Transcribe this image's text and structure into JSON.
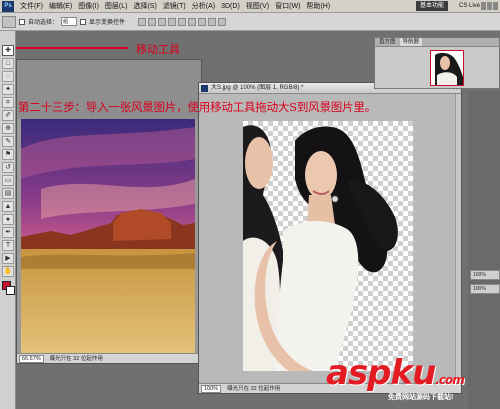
{
  "menubar": {
    "logo": "Ps",
    "items": [
      "文件(F)",
      "编辑(E)",
      "图像(I)",
      "图层(L)",
      "选择(S)",
      "滤镜(T)",
      "分析(A)",
      "3D(D)",
      "视图(V)",
      "窗口(W)",
      "帮助(H)"
    ],
    "zoom": "100%",
    "workspace": "基本功能",
    "cslive": "CS Live"
  },
  "options": {
    "auto_select_label": "自动选择：",
    "auto_select_value": "组",
    "show_transform_label": "显示变换控件"
  },
  "annotations": {
    "move_tool": "移动工具",
    "step": "第二十三步：导入一张风景图片，使用移动工具拖动大S到风景图片里。"
  },
  "documents": {
    "landscape": {
      "zoom": "66.67%",
      "status": "曝光只在 32 位起作用"
    },
    "portrait": {
      "title": "大S.jpg @ 100% (图层 1, RGB/8) *",
      "zoom": "100%",
      "status": "曝光只在 32 位起作用"
    }
  },
  "panels": {
    "navigator_tabs": [
      "直方图",
      "导航器"
    ],
    "strip_values": [
      "100%",
      "100%"
    ]
  },
  "watermark": {
    "brand_a": "asp",
    "brand_b": "ku",
    "suffix": ".com",
    "sub": "免费网站源码下载站!"
  },
  "colors": {
    "annotation_red": "#d9001b",
    "foreground": "#c8102e",
    "background": "#ffffff"
  }
}
